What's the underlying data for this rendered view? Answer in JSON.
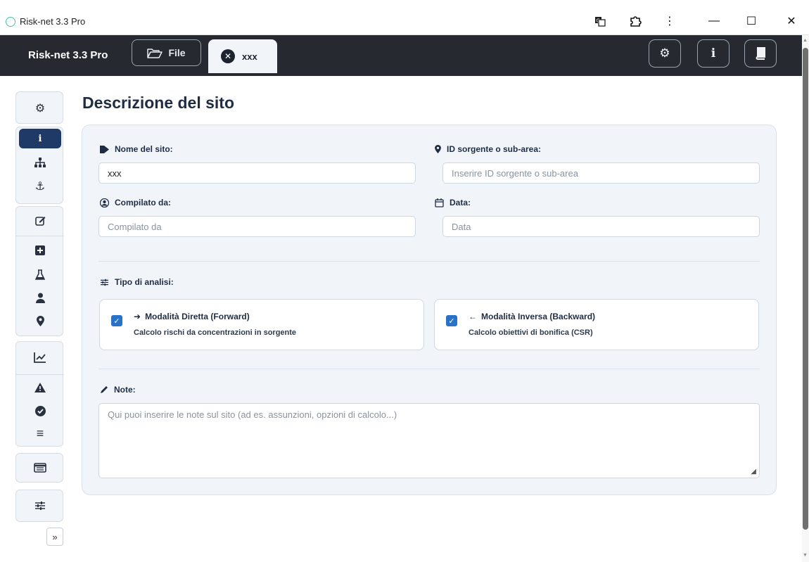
{
  "window": {
    "title": "Risk-net 3.3 Pro",
    "icons": [
      "app-logo-icon",
      "translate-icon",
      "extension-icon",
      "kebab-menu-icon",
      "minimize-icon",
      "maximize-icon",
      "close-icon"
    ],
    "minimize": "—",
    "maximize": "☐",
    "close": "✕",
    "kebab": "⋮"
  },
  "header": {
    "brand": "Risk-net 3.3 Pro",
    "file_label": "File",
    "active_tab": "xxx",
    "right_buttons": [
      "settings",
      "info",
      "manual"
    ],
    "colors": {
      "bar": "#262a30",
      "active_tab_bg": "#f1f4f8"
    }
  },
  "sidebar": {
    "groups": [
      {
        "items": [
          "gear-icon"
        ]
      },
      {
        "items": [
          "info-icon",
          "sitemap-icon",
          "anchor-icon"
        ],
        "active": "info-icon"
      },
      {
        "items": [
          "edit-icon",
          "plus-square-icon",
          "flask-icon",
          "user-icon",
          "map-marker-icon"
        ]
      },
      {
        "items": [
          "chart-line-icon",
          "warning-icon",
          "check-circle-icon",
          "bars-icon"
        ]
      },
      {
        "items": [
          "table-icon"
        ]
      },
      {
        "items": [
          "sliders-icon"
        ]
      }
    ],
    "expand_label": "»",
    "colors": {
      "active": "#1f3a66"
    }
  },
  "page": {
    "title": "Descrizione del sito"
  },
  "form": {
    "site_name": {
      "label": "Nome del sito:",
      "value": "xxx"
    },
    "source_id": {
      "label": "ID sorgente o sub-area:",
      "placeholder": "Inserire ID sorgente o sub-area"
    },
    "compiled_by": {
      "label": "Compilato da:",
      "placeholder": "Compilato da"
    },
    "date": {
      "label": "Data:",
      "placeholder": "Data"
    },
    "analysis_type": {
      "label": "Tipo di analisi:",
      "forward": {
        "title": "Modalità Diretta (Forward)",
        "subtitle": "Calcolo rischi da concentrazioni in sorgente",
        "checked": true
      },
      "backward": {
        "title": "Modalità Inversa (Backward)",
        "subtitle": "Calcolo obiettivi di bonifica (CSR)",
        "checked": true
      }
    },
    "notes": {
      "label": "Note:",
      "placeholder": "Qui puoi inserire le note sul sito (ad es. assunzioni, opzioni di calcolo...)"
    },
    "colors": {
      "checkbox": "#2a72c8",
      "card_bg": "#f1f5fa"
    }
  }
}
